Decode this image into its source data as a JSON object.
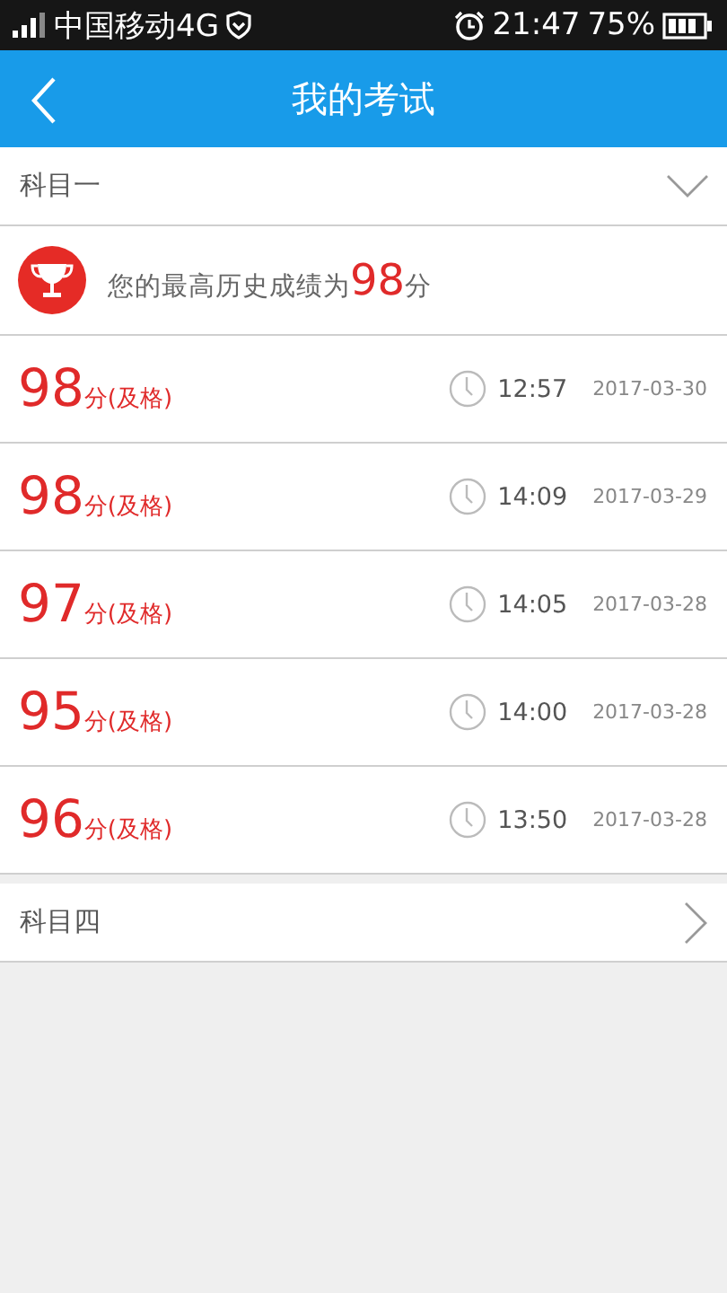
{
  "status_bar": {
    "carrier": "中国移动4G",
    "time": "21:47",
    "battery": "75%"
  },
  "header": {
    "title": "我的考试"
  },
  "subjects": [
    {
      "name": "科目一",
      "expanded": true,
      "best": {
        "label": "您的最高历史成绩为",
        "score": "98",
        "unit": "分"
      },
      "records": [
        {
          "score": "98",
          "suffix": "分(及格)",
          "time": "12:57",
          "date": "2017-03-30"
        },
        {
          "score": "98",
          "suffix": "分(及格)",
          "time": "14:09",
          "date": "2017-03-29"
        },
        {
          "score": "97",
          "suffix": "分(及格)",
          "time": "14:05",
          "date": "2017-03-28"
        },
        {
          "score": "95",
          "suffix": "分(及格)",
          "time": "14:00",
          "date": "2017-03-28"
        },
        {
          "score": "96",
          "suffix": "分(及格)",
          "time": "13:50",
          "date": "2017-03-28"
        }
      ]
    },
    {
      "name": "科目四",
      "expanded": false
    }
  ]
}
